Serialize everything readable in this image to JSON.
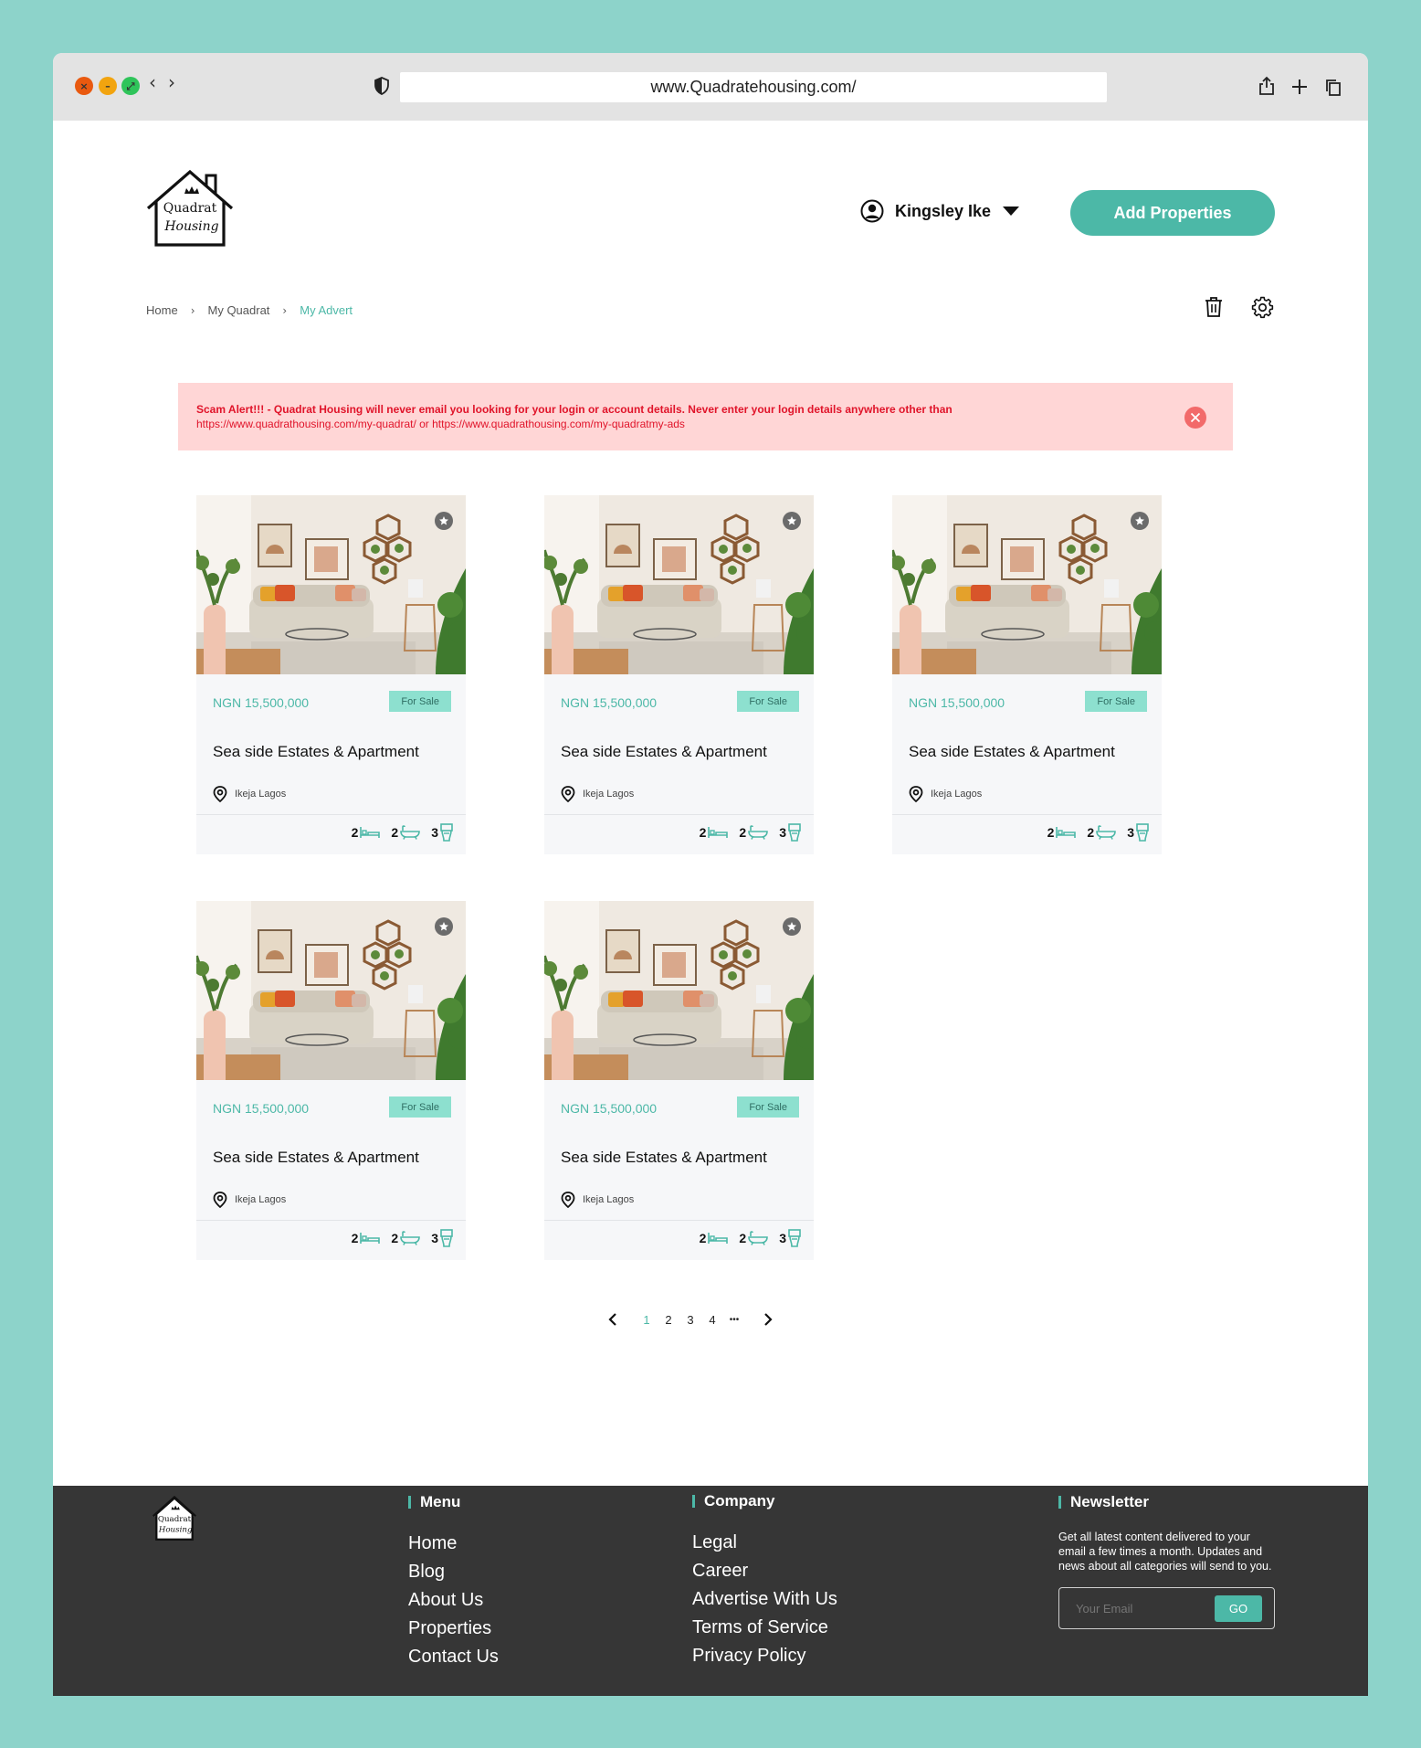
{
  "browser": {
    "url": "www.Quadratehousing.com/",
    "back_icon": "chevron-left-icon",
    "forward_icon": "chevron-right-icon"
  },
  "header": {
    "logo_line1": "Quadrat",
    "logo_line2": "Housing",
    "user_name": "Kingsley Ike",
    "add_button": "Add Properties"
  },
  "breadcrumb": [
    "Home",
    "My Quadrat",
    "My Advert"
  ],
  "alert": {
    "bold_text": "Scam Alert!!! - Quadrat Housing will never email you looking for your login or account details. Never enter your login details anywhere other than",
    "link_text": "https://www.quadrathousing.com/my-quadrat/ or https://www.quadrathousing.com/my-quadratmy-ads"
  },
  "cards": [
    {
      "price": "NGN 15,500,000",
      "tag": "For Sale",
      "title": "Sea side Estates & Apartment",
      "location": "Ikeja Lagos",
      "beds": "2",
      "baths": "2",
      "toilets": "3"
    },
    {
      "price": "NGN 15,500,000",
      "tag": "For Sale",
      "title": "Sea side Estates & Apartment",
      "location": "Ikeja Lagos",
      "beds": "2",
      "baths": "2",
      "toilets": "3"
    },
    {
      "price": "NGN 15,500,000",
      "tag": "For Sale",
      "title": "Sea side Estates & Apartment",
      "location": "Ikeja Lagos",
      "beds": "2",
      "baths": "2",
      "toilets": "3"
    },
    {
      "price": "NGN 15,500,000",
      "tag": "For Sale",
      "title": "Sea side Estates & Apartment",
      "location": "Ikeja Lagos",
      "beds": "2",
      "baths": "2",
      "toilets": "3"
    },
    {
      "price": "NGN 15,500,000",
      "tag": "For Sale",
      "title": "Sea side Estates & Apartment",
      "location": "Ikeja Lagos",
      "beds": "2",
      "baths": "2",
      "toilets": "3"
    }
  ],
  "pagination": {
    "pages": [
      "1",
      "2",
      "3",
      "4"
    ],
    "ellipsis": "•••",
    "current": "1"
  },
  "footer": {
    "menu_title": "Menu",
    "menu_items": [
      "Home",
      "Blog",
      "About Us",
      "Properties",
      "Contact Us"
    ],
    "company_title": "Company",
    "company_items": [
      "Legal",
      "Career",
      "Advertise With Us",
      "Terms of Service",
      "Privacy Policy"
    ],
    "newsletter_title": "Newsletter",
    "newsletter_text": "Get all latest content delivered to your email a few times a month. Updates and news about all categories will send to you.",
    "email_placeholder": "Your Email",
    "go_label": "GO"
  },
  "colors": {
    "accent": "#4cb8a7",
    "alert_bg": "#ffd6d6",
    "alert_text": "#e0142a",
    "footer_bg": "#363636",
    "page_bg": "#8dd3ca"
  }
}
